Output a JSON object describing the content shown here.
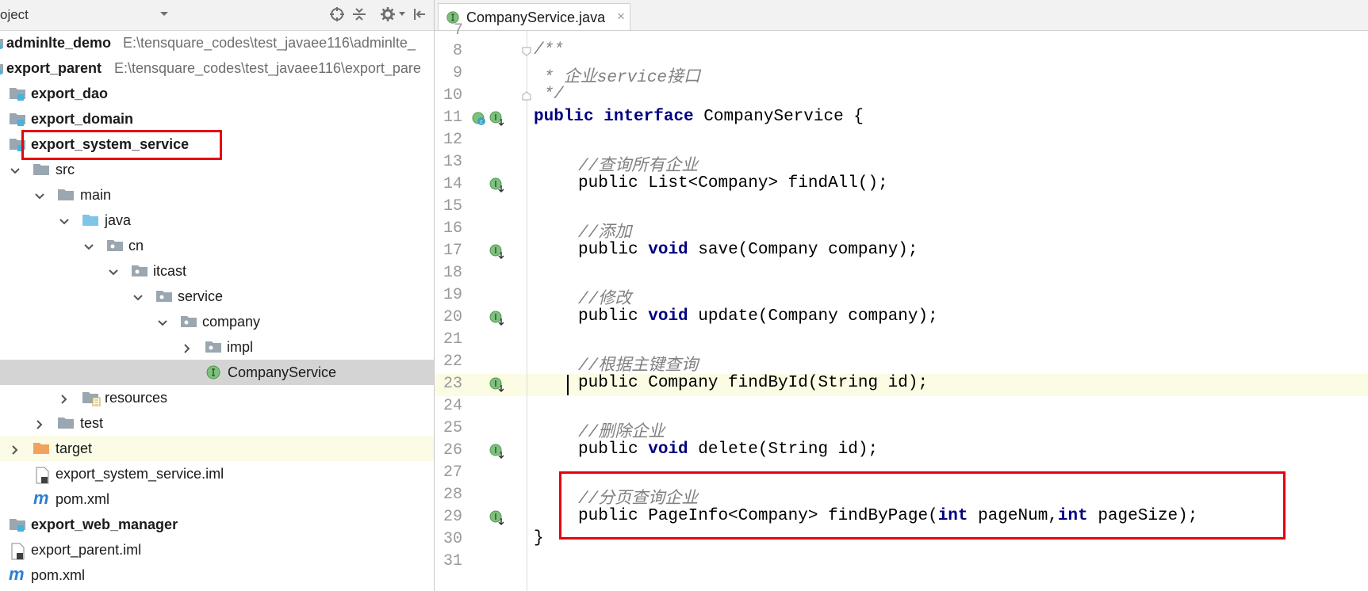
{
  "project_panel": {
    "title": "oject",
    "tree": [
      {
        "label": "adminlte_demo",
        "path": "E:\\tensquare_codes\\test_javaee116\\adminlte_",
        "bold": true
      },
      {
        "label": "export_parent",
        "path": "E:\\tensquare_codes\\test_javaee116\\export_pare",
        "bold": true
      },
      {
        "label": "export_dao",
        "bold": true
      },
      {
        "label": "export_domain",
        "bold": true
      },
      {
        "label": "export_system_service",
        "bold": true
      },
      {
        "label": "src"
      },
      {
        "label": "main"
      },
      {
        "label": "java"
      },
      {
        "label": "cn"
      },
      {
        "label": "itcast"
      },
      {
        "label": "service"
      },
      {
        "label": "company"
      },
      {
        "label": "impl"
      },
      {
        "label": "CompanyService",
        "selected": true
      },
      {
        "label": "resources"
      },
      {
        "label": "test"
      },
      {
        "label": "target"
      },
      {
        "label": "export_system_service.iml"
      },
      {
        "label": "pom.xml"
      },
      {
        "label": "export_web_manager",
        "bold": true
      },
      {
        "label": "export_parent.iml"
      },
      {
        "label": "pom.xml"
      }
    ]
  },
  "editor": {
    "tab": {
      "label": "CompanyService.java",
      "close": "×"
    },
    "current_line": 23,
    "lines": [
      {
        "num": "7",
        "text": ""
      },
      {
        "num": "8",
        "text": "/**"
      },
      {
        "num": "9",
        "text": " * 企业service接口"
      },
      {
        "num": "10",
        "text": " */"
      },
      {
        "num": "11",
        "kw1": "public",
        "kw2": "interface",
        "text": " CompanyService {"
      },
      {
        "num": "12",
        "text": ""
      },
      {
        "num": "13",
        "comment": "//查询所有企业"
      },
      {
        "num": "14",
        "kw1": "public",
        "text": " List<Company> findAll();"
      },
      {
        "num": "15",
        "text": ""
      },
      {
        "num": "16",
        "comment": "//添加"
      },
      {
        "num": "17",
        "kw1": "public",
        "kw2": "void",
        "text": " save(Company company);"
      },
      {
        "num": "18",
        "text": ""
      },
      {
        "num": "19",
        "comment": "//修改"
      },
      {
        "num": "20",
        "kw1": "public",
        "kw2": "void",
        "text": " update(Company company);"
      },
      {
        "num": "21",
        "text": ""
      },
      {
        "num": "22",
        "comment": "//根据主键查询"
      },
      {
        "num": "23",
        "kw1": "public",
        "text": " Company findById(String id);"
      },
      {
        "num": "24",
        "text": ""
      },
      {
        "num": "25",
        "comment": "//删除企业"
      },
      {
        "num": "26",
        "kw1": "public",
        "kw2": "void",
        "text": " delete(String id);"
      },
      {
        "num": "27",
        "text": ""
      },
      {
        "num": "28",
        "comment": "//分页查询企业"
      },
      {
        "num": "29",
        "kw1": "public",
        "text_a": " PageInfo<Company> findByPage(",
        "kw3": "int",
        "text_b": " pageNum,",
        "kw4": "int",
        "text_c": " pageSize);"
      },
      {
        "num": "30",
        "text": "}"
      },
      {
        "num": "31",
        "text": ""
      }
    ]
  },
  "colors": {
    "keyword": "#000080",
    "comment": "#808080",
    "highlight_box": "#e60012",
    "current_line": "#fcfbe3",
    "selection": "#d4d4d4"
  }
}
